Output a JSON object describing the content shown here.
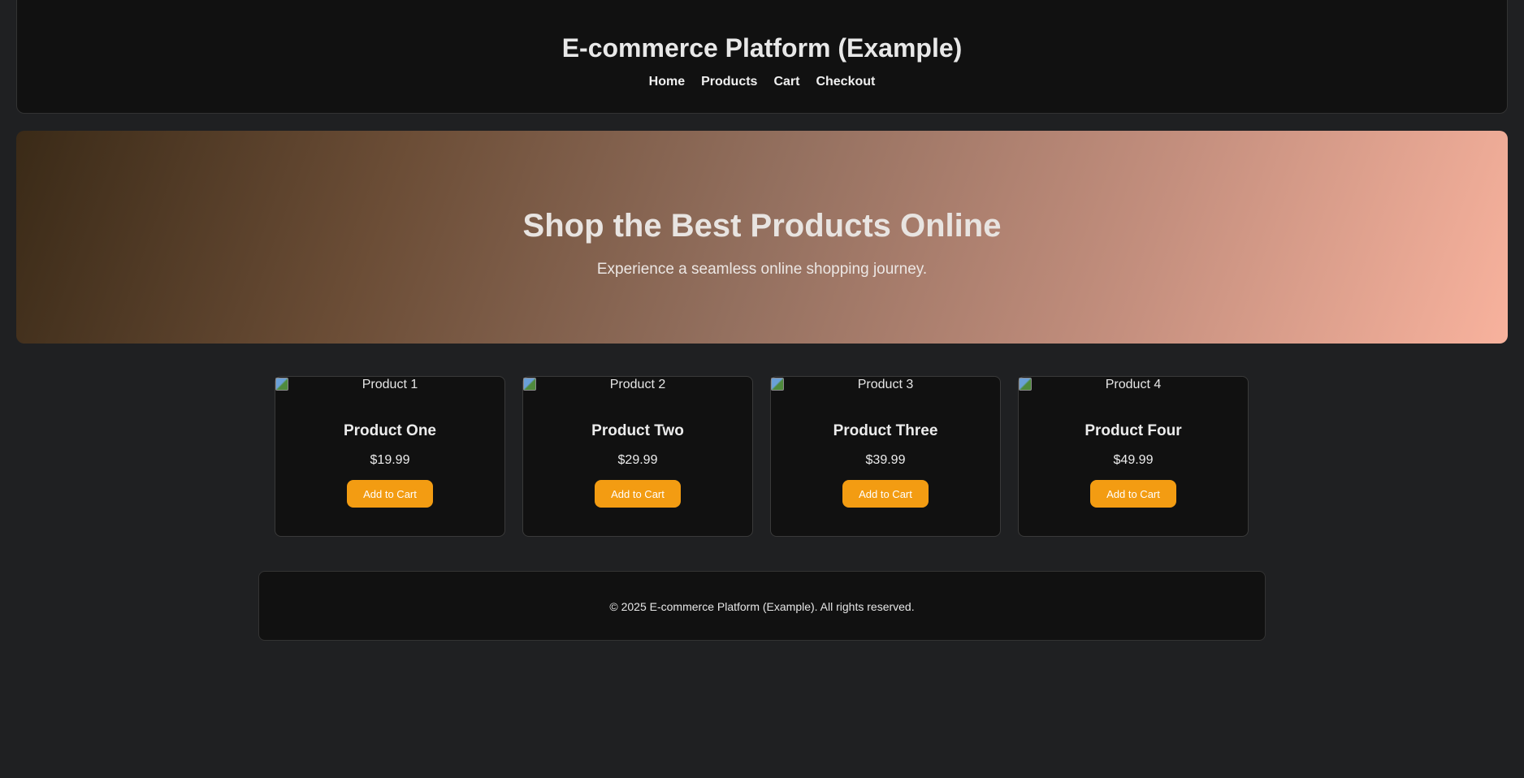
{
  "header": {
    "title": "E-commerce Platform (Example)",
    "nav": [
      "Home",
      "Products",
      "Cart",
      "Checkout"
    ]
  },
  "hero": {
    "title": "Shop the Best Products Online",
    "subtitle": "Experience a seamless online shopping journey."
  },
  "products": [
    {
      "alt": "Product 1",
      "name": "Product One",
      "price": "$19.99",
      "button": "Add to Cart"
    },
    {
      "alt": "Product 2",
      "name": "Product Two",
      "price": "$29.99",
      "button": "Add to Cart"
    },
    {
      "alt": "Product 3",
      "name": "Product Three",
      "price": "$39.99",
      "button": "Add to Cart"
    },
    {
      "alt": "Product 4",
      "name": "Product Four",
      "price": "$49.99",
      "button": "Add to Cart"
    }
  ],
  "footer": {
    "text": "© 2025 E-commerce Platform (Example). All rights reserved."
  },
  "colors": {
    "accent": "#f39c12",
    "background": "#1f2022",
    "panel": "#111111"
  }
}
